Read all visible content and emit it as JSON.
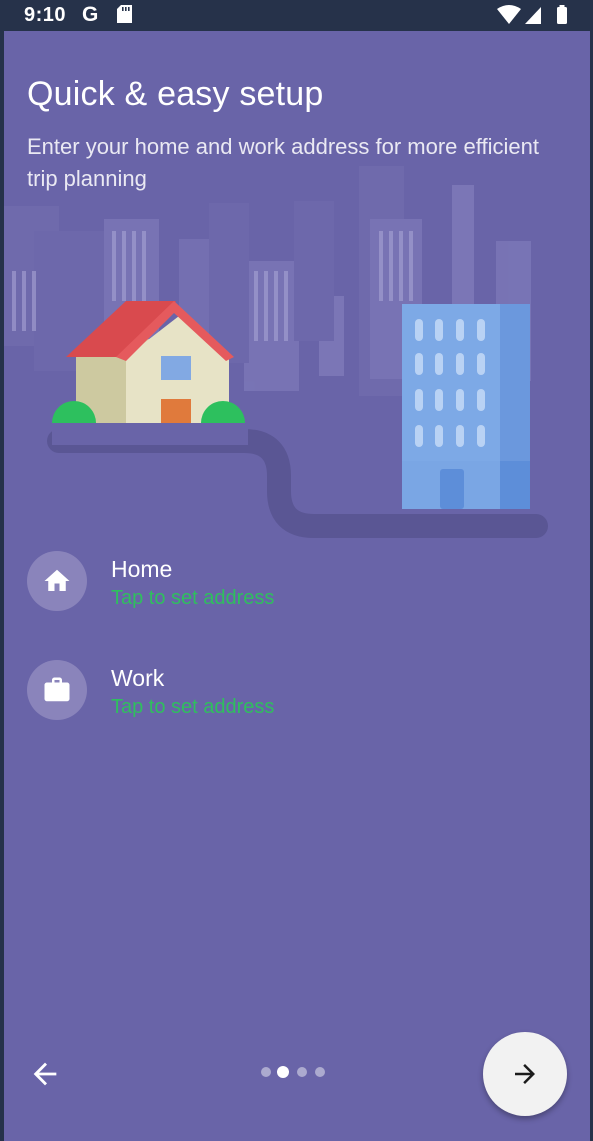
{
  "status_bar": {
    "time": "9:10",
    "g_label": "G"
  },
  "header": {
    "title": "Quick & easy setup",
    "subtitle": "Enter your home and work address for more efficient trip planning"
  },
  "addresses": [
    {
      "label": "Home",
      "hint": "Tap to set address",
      "icon": "home-icon"
    },
    {
      "label": "Work",
      "hint": "Tap to set address",
      "icon": "briefcase-icon"
    }
  ],
  "pager": {
    "page_count": 4,
    "current_page": 2
  },
  "colors": {
    "background": "#6964a8",
    "status_bar": "#26324a",
    "hint_green": "#2fbf5e",
    "fab": "#f2f2f2"
  }
}
